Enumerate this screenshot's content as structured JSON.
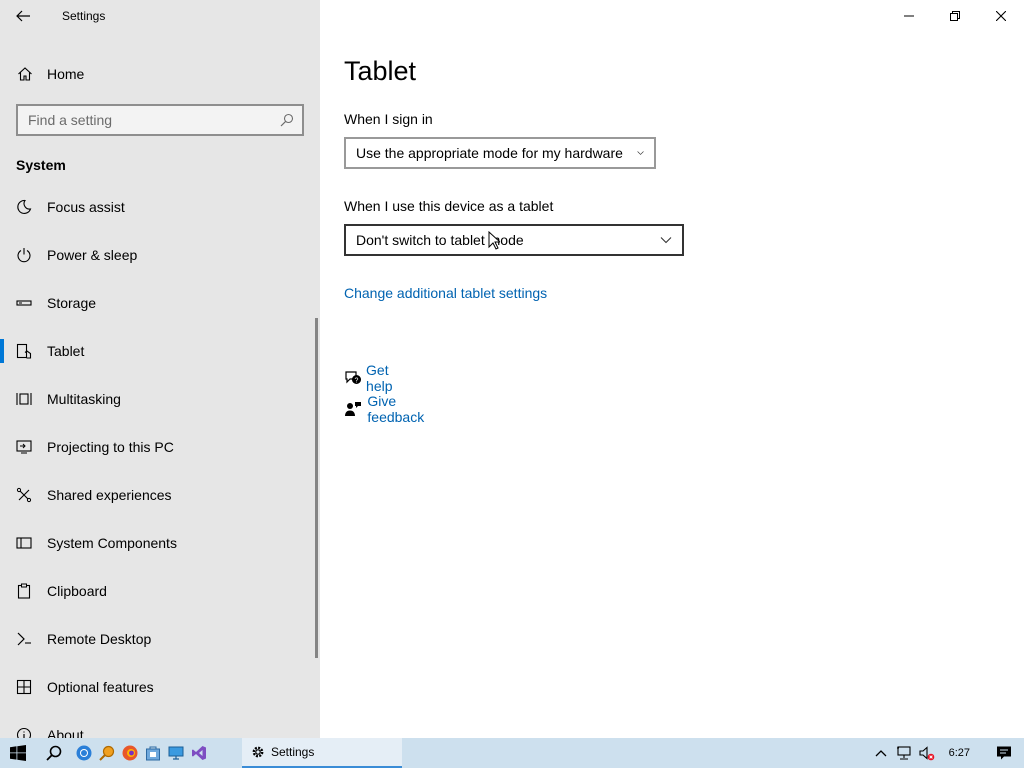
{
  "window": {
    "app_title": "Settings"
  },
  "sidebar": {
    "home_label": "Home",
    "search_placeholder": "Find a setting",
    "section_title": "System",
    "items": [
      {
        "label": "Focus assist",
        "icon": "moon-icon"
      },
      {
        "label": "Power & sleep",
        "icon": "power-icon"
      },
      {
        "label": "Storage",
        "icon": "storage-icon"
      },
      {
        "label": "Tablet",
        "icon": "tablet-icon",
        "selected": true
      },
      {
        "label": "Multitasking",
        "icon": "multitasking-icon"
      },
      {
        "label": "Projecting to this PC",
        "icon": "projecting-icon"
      },
      {
        "label": "Shared experiences",
        "icon": "shared-experiences-icon"
      },
      {
        "label": "System Components",
        "icon": "system-components-icon"
      },
      {
        "label": "Clipboard",
        "icon": "clipboard-icon"
      },
      {
        "label": "Remote Desktop",
        "icon": "remote-desktop-icon"
      },
      {
        "label": "Optional features",
        "icon": "optional-features-icon"
      },
      {
        "label": "About",
        "icon": "about-icon"
      }
    ]
  },
  "main": {
    "title": "Tablet",
    "sign_in_label": "When I sign in",
    "sign_in_value": "Use the appropriate mode for my hardware",
    "tablet_use_label": "When I use this device as a tablet",
    "tablet_use_value": "Don't switch to tablet mode",
    "additional_link": "Change additional tablet settings",
    "get_help": "Get help",
    "give_feedback": "Give feedback"
  },
  "taskbar": {
    "active_app_label": "Settings",
    "clock": "6:27"
  },
  "colors": {
    "accent": "#0078d7",
    "link": "#0063b1",
    "sidebar_bg": "#e6e6e6",
    "taskbar_bg": "#cde0ee"
  }
}
